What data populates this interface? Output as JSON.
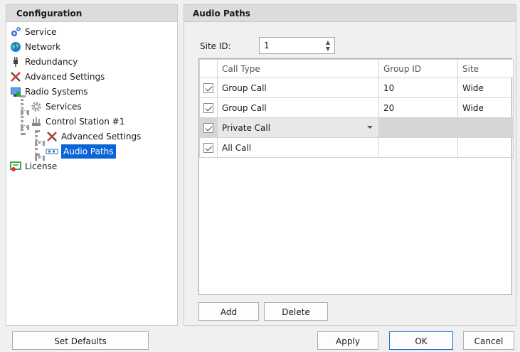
{
  "left_panel": {
    "title": "Configuration",
    "tree": [
      {
        "label": "Service",
        "icon": "gear-cog-icon"
      },
      {
        "label": "Network",
        "icon": "globe-icon"
      },
      {
        "label": "Redundancy",
        "icon": "plug-icon"
      },
      {
        "label": "Advanced Settings",
        "icon": "tools-icon"
      },
      {
        "label": "Radio Systems",
        "icon": "monitor-icon"
      },
      {
        "label": "Services",
        "icon": "gear-icon"
      },
      {
        "label": "Control Station #1",
        "icon": "network-hub-icon"
      },
      {
        "label": "Advanced Settings",
        "icon": "tools-icon"
      },
      {
        "label": "Audio Paths",
        "icon": "audio-path-icon",
        "selected": true
      },
      {
        "label": "License",
        "icon": "license-icon"
      }
    ]
  },
  "right_panel": {
    "title": "Audio Paths",
    "site_id_label": "Site ID:",
    "site_id_value": "1",
    "grid": {
      "columns": [
        "",
        "Call Type",
        "Group ID",
        "Site"
      ],
      "rows": [
        {
          "checked": true,
          "call_type": "Group Call",
          "group_id": "10",
          "site": "Wide"
        },
        {
          "checked": true,
          "call_type": "Group Call",
          "group_id": "20",
          "site": "Wide"
        },
        {
          "checked": true,
          "call_type": "Private Call",
          "group_id": "",
          "site": "",
          "editing": true
        },
        {
          "checked": true,
          "call_type": "All Call",
          "group_id": "",
          "site": ""
        }
      ]
    },
    "add_label": "Add",
    "delete_label": "Delete"
  },
  "footer": {
    "set_defaults_label": "Set Defaults",
    "apply_label": "Apply",
    "ok_label": "OK",
    "cancel_label": "Cancel"
  },
  "colors": {
    "selection": "#0a64d8",
    "primary_border": "#1a6fd6",
    "header_bg": "#dcdcdc"
  }
}
